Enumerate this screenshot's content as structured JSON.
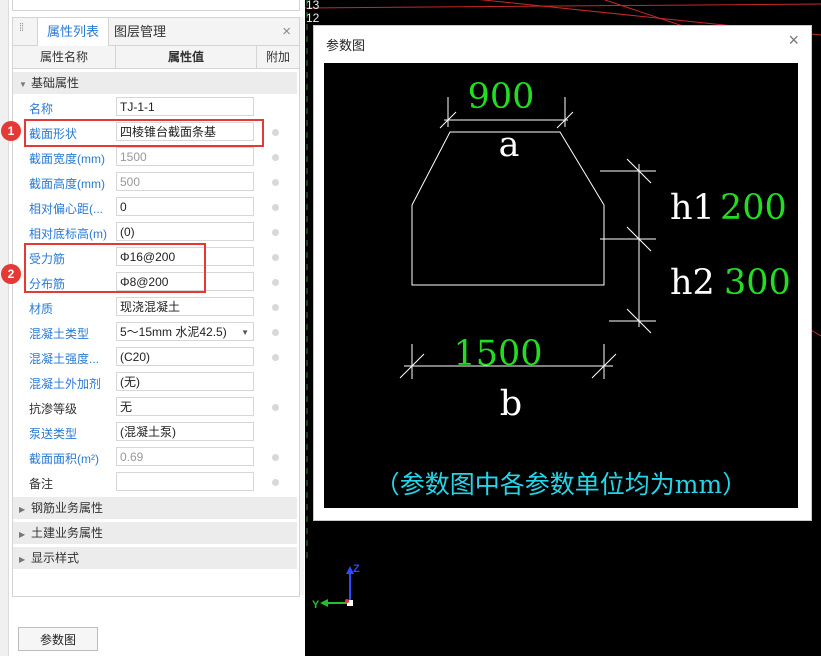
{
  "panel": {
    "tabs": [
      {
        "label": "属性列表",
        "active": true
      },
      {
        "label": "图层管理",
        "active": false
      }
    ],
    "close_icon": "×",
    "columns": [
      "属性名称",
      "属性值",
      "附加"
    ],
    "groups": {
      "basic": "基础属性",
      "rebar_business": "钢筋业务属性",
      "civil_business": "土建业务属性",
      "display_style": "显示样式"
    },
    "rows": [
      {
        "name": "名称",
        "value": "TJ-1-1",
        "link": true,
        "value_gray": false,
        "dot": false
      },
      {
        "name": "截面形状",
        "value": "四棱锥台截面条基",
        "link": true,
        "value_gray": false,
        "dot": true
      },
      {
        "name": "截面宽度(mm)",
        "value": "1500",
        "link": true,
        "value_gray": true,
        "dot": true
      },
      {
        "name": "截面高度(mm)",
        "value": "500",
        "link": true,
        "value_gray": true,
        "dot": true
      },
      {
        "name": "相对偏心距(...",
        "value": "0",
        "link": true,
        "value_gray": false,
        "dot": true
      },
      {
        "name": "相对底标高(m)",
        "value": "(0)",
        "link": true,
        "value_gray": false,
        "dot": true
      },
      {
        "name": "受力筋",
        "value": "Φ16@200",
        "link": true,
        "value_gray": false,
        "dot": true
      },
      {
        "name": "分布筋",
        "value": "Φ8@200",
        "link": true,
        "value_gray": false,
        "dot": true
      },
      {
        "name": "材质",
        "value": "现浇混凝土",
        "link": true,
        "value_gray": false,
        "dot": true
      },
      {
        "name": "混凝土类型",
        "value": "5～15mm 水泥42.5)",
        "link": true,
        "value_gray": false,
        "dot": true,
        "dropdown": true
      },
      {
        "name": "混凝土强度...",
        "value": "(C20)",
        "link": true,
        "value_gray": false,
        "dot": true
      },
      {
        "name": "混凝土外加剂",
        "value": "(无)",
        "link": true,
        "value_gray": false,
        "dot": false
      },
      {
        "name": "抗渗等级",
        "value": "无",
        "link": false,
        "value_gray": false,
        "dot": true
      },
      {
        "name": "泵送类型",
        "value": "(混凝土泵)",
        "link": true,
        "value_gray": false,
        "dot": false
      },
      {
        "name": "截面面积(m²)",
        "value": "0.69",
        "link": true,
        "value_gray": true,
        "dot": true
      },
      {
        "name": "备注",
        "value": "",
        "link": false,
        "value_gray": false,
        "dot": true
      }
    ],
    "badges": [
      "1",
      "2"
    ],
    "button": "参数图"
  },
  "dialog": {
    "title": "参数图",
    "close_icon": "×",
    "top_width_value": "900",
    "top_width_name": "a",
    "h1_name": "h1",
    "h1_value": "200",
    "h2_name": "h2",
    "h2_value": "300",
    "bottom_width_value": "1500",
    "bottom_width_name": "b",
    "note": "（参数图中各参数单位均为mm）"
  },
  "cad": {
    "bg_numbers": [
      "13",
      "12"
    ],
    "axis_z": "Z",
    "axis_y": "Y"
  },
  "colors": {
    "link_blue": "#2a7ad6",
    "highlight_red": "#e53935",
    "dim_green": "#22dd22",
    "note_cyan": "#22d6e8",
    "cad_bg": "#000000"
  }
}
